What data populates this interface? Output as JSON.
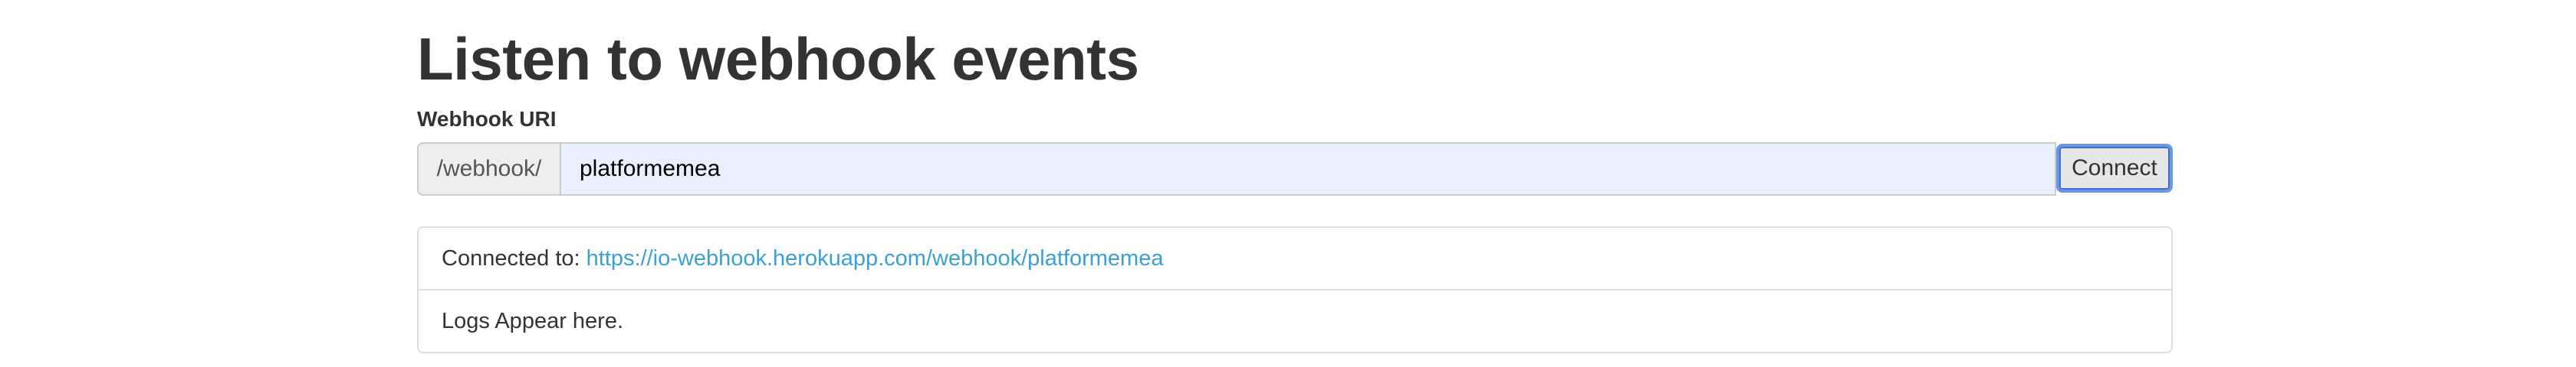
{
  "page": {
    "title": "Listen to webhook events"
  },
  "form": {
    "label": "Webhook URI",
    "prefix": "/webhook/",
    "input_value": "platformemea",
    "connect_label": "Connect"
  },
  "status": {
    "connected_prefix": "Connected to:",
    "connected_url": "https://io-webhook.herokuapp.com/webhook/platformemea",
    "logs_text": "Logs Appear here."
  },
  "colors": {
    "link": "#3aa0d8",
    "input_background": "#e8f0fe",
    "focus_ring": "#6b96e0"
  }
}
